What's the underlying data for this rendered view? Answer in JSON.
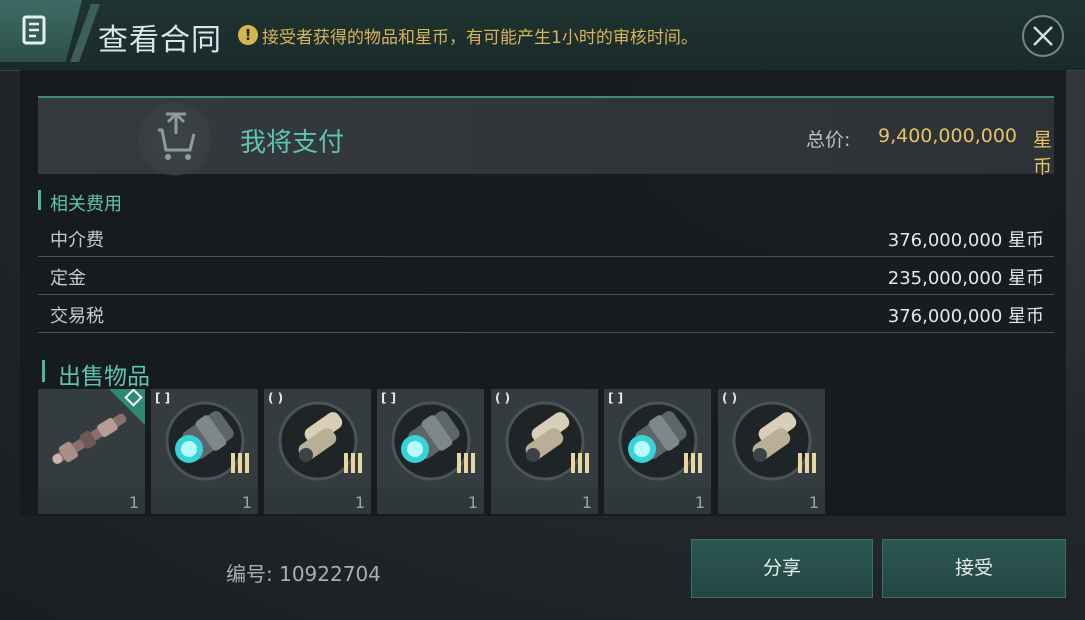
{
  "header": {
    "title": "查看合同",
    "notice": "接受者获得的物品和星币，有可能产生1小时的审核时间。"
  },
  "payment": {
    "label": "我将支付",
    "total_label": "总价:",
    "total_value": "9,400,000,000",
    "currency": "星币"
  },
  "fees": {
    "title": "相关费用",
    "rows": [
      {
        "name": "中介费",
        "value": "376,000,000 星币"
      },
      {
        "name": "定金",
        "value": "235,000,000 星币"
      },
      {
        "name": "交易税",
        "value": "376,000,000 星币"
      }
    ]
  },
  "items": {
    "title": "出售物品",
    "list": [
      {
        "icon": "ship-icon",
        "mark": "",
        "count": "1"
      },
      {
        "icon": "cyan-turret-module-icon",
        "mark": "[ ]",
        "count": "1"
      },
      {
        "icon": "missile-launcher-icon",
        "mark": "( )",
        "count": "1"
      },
      {
        "icon": "cyan-turret-module-icon",
        "mark": "[ ]",
        "count": "1"
      },
      {
        "icon": "missile-launcher-icon",
        "mark": "( )",
        "count": "1"
      },
      {
        "icon": "cyan-turret-module-icon",
        "mark": "[ ]",
        "count": "1"
      },
      {
        "icon": "missile-launcher-icon",
        "mark": "( )",
        "count": "1"
      }
    ]
  },
  "footer": {
    "contract_id": "编号: 10922704",
    "share_label": "分享",
    "accept_label": "接受"
  },
  "colors": {
    "accent": "#5ec3b1",
    "gold": "#e7c266",
    "button": "#2c5752"
  }
}
